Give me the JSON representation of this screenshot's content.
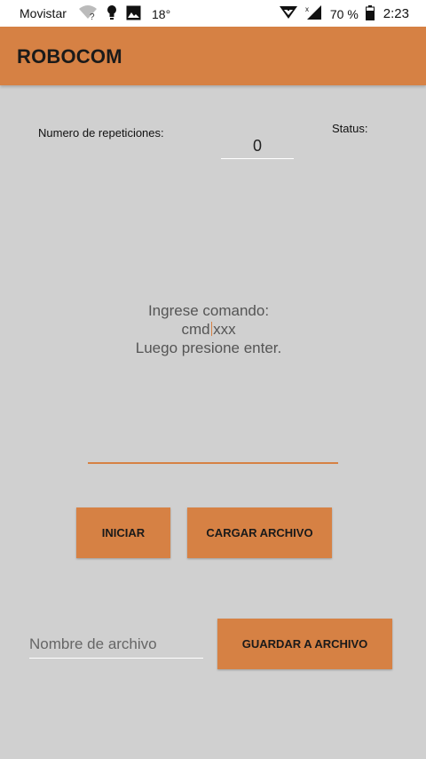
{
  "status_bar": {
    "carrier": "Movistar",
    "temperature": "18°",
    "battery": "70 %",
    "time": "2:23"
  },
  "app": {
    "title": "ROBOCOM"
  },
  "main": {
    "repetitions_label": "Numero de repeticiones:",
    "repetitions_value": "0",
    "status_label": "Status:",
    "instructions": {
      "line1": "Ingrese comando:",
      "line2_before_cursor": "cmd",
      "line2_after_cursor": "xxx",
      "line3": "Luego presione enter."
    },
    "buttons": {
      "start": "INICIAR",
      "load_file": "CARGAR ARCHIVO",
      "save_file": "GUARDAR A ARCHIVO"
    },
    "filename_placeholder": "Nombre de archivo"
  },
  "colors": {
    "accent": "#d68144",
    "background": "#d0d0d0"
  }
}
